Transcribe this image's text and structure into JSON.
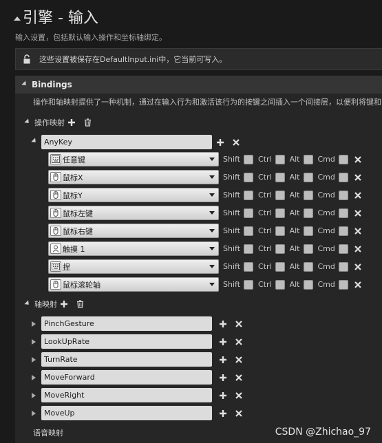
{
  "header": {
    "title": "引擎 - 输入",
    "subtitle": "输入设置，包括默认输入操作和坐标轴绑定。"
  },
  "notice": {
    "text": "这些设置被保存在DefaultInput.ini中，它当前可写入。"
  },
  "bindings": {
    "title": "Bindings",
    "description": "操作和轴映射提供了一种机制，通过在输入行为和激活该行为的按键之间插入一个间接层，以便利将键和"
  },
  "action_mappings": {
    "label": "操作映射",
    "mapping": {
      "name": "AnyKey",
      "keys": [
        {
          "key": "任意键",
          "icon": "keyboard-icon"
        },
        {
          "key": "鼠标X",
          "icon": "mouse-icon"
        },
        {
          "key": "鼠标Y",
          "icon": "mouse-icon"
        },
        {
          "key": "鼠标左键",
          "icon": "mouse-icon"
        },
        {
          "key": "鼠标右键",
          "icon": "mouse-icon"
        },
        {
          "key": "触摸 1",
          "icon": "touch-icon"
        },
        {
          "key": "捏",
          "icon": "keyboard-icon"
        },
        {
          "key": "鼠标滚轮轴",
          "icon": "mouse-icon"
        }
      ]
    }
  },
  "modifiers": [
    "Shift",
    "Ctrl",
    "Alt",
    "Cmd"
  ],
  "axis_mappings": {
    "label": "轴映射",
    "items": [
      "PinchGesture",
      "LookUpRate",
      "TurnRate",
      "MoveForward",
      "MoveRight",
      "MoveUp"
    ]
  },
  "speech_mappings": {
    "label": "语音映射"
  },
  "watermark": "CSDN @Zhichao_97",
  "colors": {
    "background": "#1a1a1a",
    "panel": "#262626",
    "field": "#dcdcdc"
  }
}
